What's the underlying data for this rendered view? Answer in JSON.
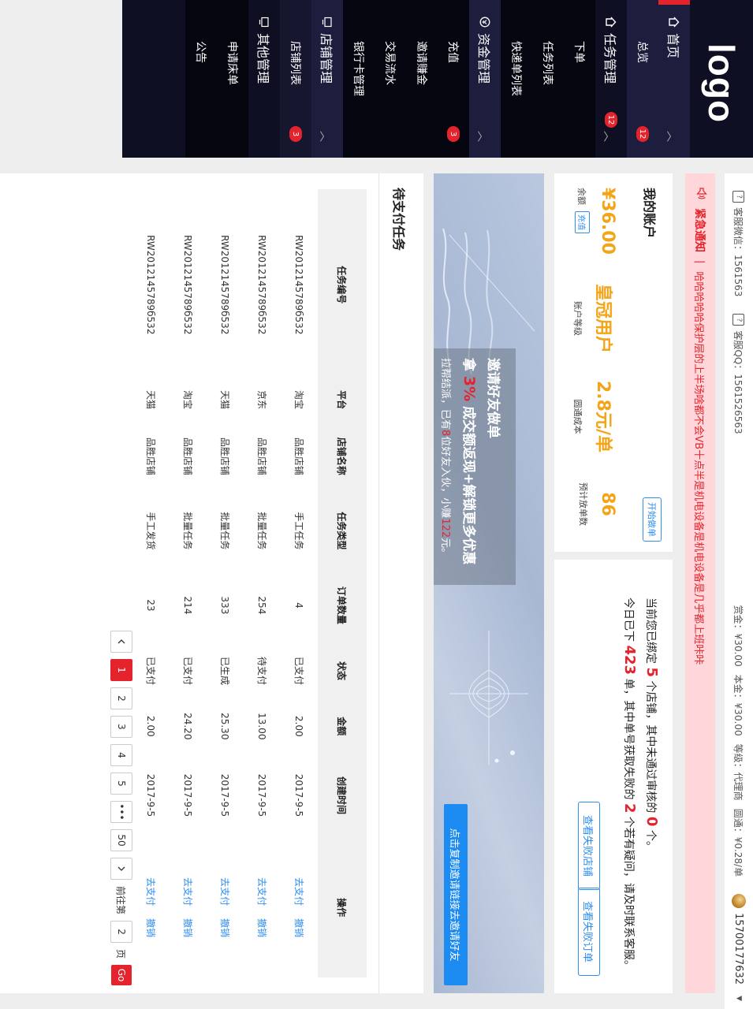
{
  "sidebar": {
    "logo": "logo",
    "groups": [
      {
        "label": "首页",
        "items": [
          {
            "label": "总览",
            "badge": "12"
          }
        ]
      },
      {
        "label": "任务管理",
        "badge": "12",
        "items": [
          {
            "label": "下单"
          },
          {
            "label": "任务列表"
          },
          {
            "label": "快递单列表"
          }
        ]
      },
      {
        "label": "资金管理",
        "badge": "3",
        "items": [
          {
            "label": "充值"
          },
          {
            "label": "邀请赚金"
          },
          {
            "label": "交易流水"
          },
          {
            "label": "银行卡管理"
          }
        ]
      },
      {
        "label": "店铺管理",
        "items": [
          {
            "label": "店铺列表",
            "badge": "3"
          }
        ]
      },
      {
        "label": "其他管理",
        "items": [
          {
            "label": "申请床单"
          },
          {
            "label": "公告"
          }
        ]
      }
    ]
  },
  "topbar": {
    "wechat": "客服微信：1561563",
    "qq": "客服QQ：1561526563",
    "reward": "赏金：¥30.00",
    "principal": "本金：¥30.00",
    "level": "等级：代理商",
    "commission": "圆通：¥0.28/单",
    "user": "15700177632"
  },
  "notice": {
    "title": "紧急通知",
    "separator": "|",
    "text": "哈哈哈哈哈保护层的上半场啥都不会VB十点半是机电设备是机电设备是几乎都上班咔咔"
  },
  "account": {
    "title": "我的账户",
    "start_button": "开始做单",
    "balance": "¥36.00",
    "balance_label": "余额",
    "recharge": "充值",
    "level": "皇冠用户",
    "level_label": "账户等级",
    "cost": "2.8元/单",
    "cost_label": "圆通成本",
    "estimate": "86",
    "estimate_label": "预计放单数"
  },
  "shops": {
    "line1_a": "当前您已绑定",
    "bound": "5",
    "line1_b": "个店铺，其中未通过审核的",
    "failed": "0",
    "line1_c": "个。",
    "line2_a": "今日已下",
    "orders": "423",
    "line2_b": "单，其中单号获取失败的",
    "failed_orders": "2",
    "line2_c": "个若有疑问，请及时联系客服。",
    "btn_shops": "查看失败店铺",
    "btn_orders": "查看失败订单"
  },
  "banner": {
    "title": "邀请好友做单",
    "line2_a": "拿",
    "pct": "3%",
    "line2_b": "成交额返现+解锁更多优惠",
    "line3_a": "拉帮结派，已有",
    "friends": "8",
    "line3_b": "位好友入伙，小赚",
    "earned": "122",
    "line3_c": "元。",
    "cta": "点击复制邀请链接去邀请好友"
  },
  "tasks": {
    "title": "待支付任务",
    "columns": [
      "任务编号",
      "平台",
      "店铺名称",
      "任务类型",
      "订单数量",
      "状态",
      "金额",
      "创建时间",
      "操作"
    ],
    "rows": [
      [
        "RW2012145789б532",
        "淘宝",
        "品胜店铺",
        "手工任务",
        "4",
        "已支付",
        "2.00",
        "2017-9-5"
      ],
      [
        "RW2012145789б532",
        "京东",
        "品胜店铺",
        "批量任务",
        "254",
        "待支付",
        "13.00",
        "2017-9-5"
      ],
      [
        "RW2012145789б532",
        "天猫",
        "品胜店铺",
        "批量任务",
        "333",
        "已生成",
        "25.30",
        "2017-9-5"
      ],
      [
        "RW2012145789б532",
        "淘宝",
        "品胜店铺",
        "批量任务",
        "214",
        "已支付",
        "24.20",
        "2017-9-5"
      ],
      [
        "RW2012145789б532",
        "天猫",
        "品胜店铺",
        "手工发货",
        "23",
        "已支付",
        "2.00",
        "2017-9-5"
      ]
    ],
    "op_pay": "去支付",
    "op_cancel": "撤销"
  },
  "pager": {
    "pages": [
      "1",
      "2",
      "3",
      "4",
      "5"
    ],
    "ellipsis": "•••",
    "last": "50",
    "goto_label": "前往第",
    "goto_value": "2",
    "page_unit": "页",
    "go": "Go"
  }
}
